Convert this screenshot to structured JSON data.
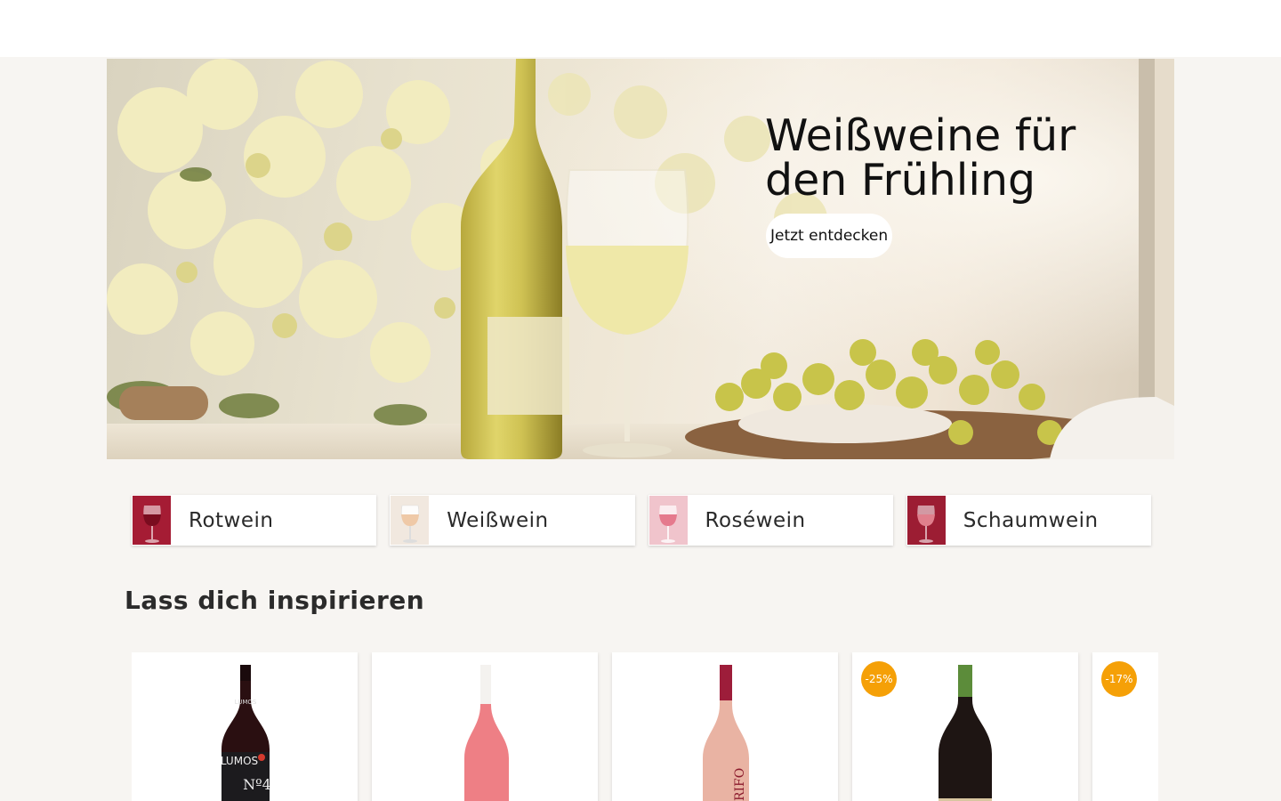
{
  "hero": {
    "title": "Weißweine für den Frühling",
    "cta_label": "Jetzt entdecken"
  },
  "categories": [
    {
      "label": "Rotwein",
      "icon": "red-wine-glass-icon",
      "color": "#a51c34"
    },
    {
      "label": "Weißwein",
      "icon": "white-wine-glass-icon",
      "color": "#f1e8df"
    },
    {
      "label": "Roséwein",
      "icon": "rose-wine-glass-icon",
      "color": "#f0c4cc"
    },
    {
      "label": "Schaumwein",
      "icon": "sparkling-wine-glass-icon",
      "color": "#9c1d33"
    }
  ],
  "inspiration": {
    "title": "Lass dich inspirieren",
    "products": [
      {
        "name": "Lumos No 4",
        "label_text": "LUMOS",
        "label_number": "Nº4",
        "badge": "",
        "bottle_color": "#2a0f11"
      },
      {
        "name": "Rosé bottle",
        "badge": "",
        "bottle_color": "#ee7f85"
      },
      {
        "name": "Grifo rosé",
        "label_text": "GRIFO",
        "badge": "",
        "bottle_color": "#e9b3a3"
      },
      {
        "name": "Red wine green cap",
        "badge": "-25%",
        "bottle_color": "#1e1513"
      },
      {
        "name": "Partially visible product",
        "badge": "-17%",
        "bottle_color": "#ffffff"
      }
    ]
  },
  "colors": {
    "accent_badge": "#f5a007",
    "background": "#f7f5f2"
  }
}
